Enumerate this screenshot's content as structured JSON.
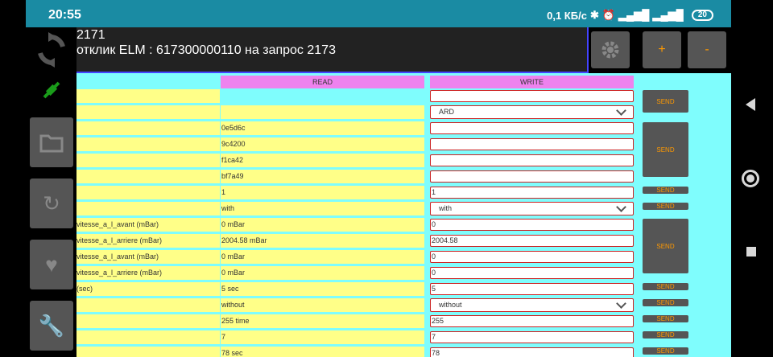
{
  "status_bar": {
    "time": "20:55",
    "net_speed": "0,1 КБ/с",
    "battery": "20"
  },
  "header": {
    "line1": "2171",
    "line2": "отклик ELM : 617300000110 на запрос 2173",
    "plus": "+",
    "minus": "-"
  },
  "columns": {
    "read": "READ",
    "write": "WRITE"
  },
  "send_label": "SEND",
  "rows": [
    {
      "label": "",
      "read": "",
      "write": "",
      "dropdown": false
    },
    {
      "label": "",
      "read": "",
      "write": "ARD",
      "dropdown": true
    },
    {
      "label": "",
      "read": "0e5d6c",
      "write": "",
      "dropdown": false
    },
    {
      "label": "",
      "read": "9c4200",
      "write": "",
      "dropdown": false
    },
    {
      "label": "",
      "read": "f1ca42",
      "write": "",
      "dropdown": false
    },
    {
      "label": "",
      "read": "bf7a49",
      "write": "",
      "dropdown": false
    },
    {
      "label": "",
      "read": "1",
      "write": "1",
      "dropdown": false
    },
    {
      "label": "",
      "read": "with",
      "write": "with",
      "dropdown": true
    },
    {
      "label": "vitesse_a_l_avant (mBar)",
      "read": "0 mBar",
      "write": "0",
      "dropdown": false
    },
    {
      "label": "vitesse_a_l_arriere (mBar)",
      "read": "2004.58 mBar",
      "write": "2004.58",
      "dropdown": false
    },
    {
      "label": "vitesse_a_l_avant (mBar)",
      "read": "0 mBar",
      "write": "0",
      "dropdown": false
    },
    {
      "label": "vitesse_a_l_arriere (mBar)",
      "read": "0 mBar",
      "write": "0",
      "dropdown": false
    },
    {
      "label": " (sec)",
      "read": "5 sec",
      "write": "5",
      "dropdown": false
    },
    {
      "label": "",
      "read": "without",
      "write": "without",
      "dropdown": true
    },
    {
      "label": "",
      "read": "255 time",
      "write": "255",
      "dropdown": false
    },
    {
      "label": "",
      "read": "7",
      "write": "7",
      "dropdown": false
    },
    {
      "label": "",
      "read": "78 sec",
      "write": "78",
      "dropdown": false
    }
  ]
}
